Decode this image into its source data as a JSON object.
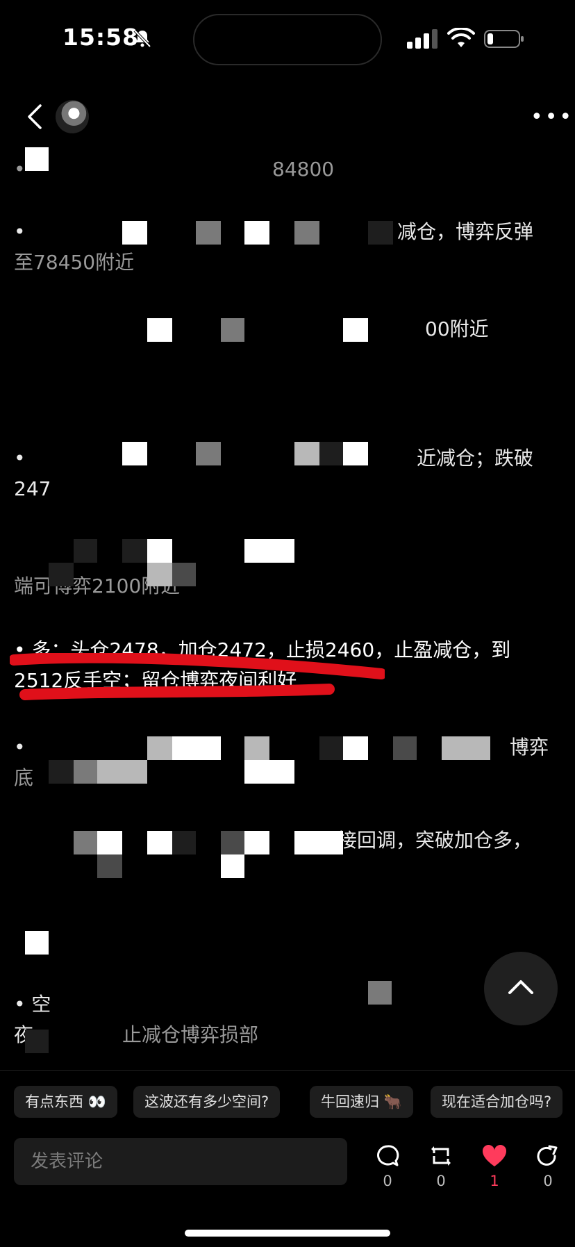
{
  "status": {
    "time": "15:58"
  },
  "post": {
    "lines": [
      {
        "text": "•",
        "tail": "84800"
      },
      {
        "text": "•",
        "tail": "减仓，博弈反弹"
      },
      {
        "text": "至78450附近"
      },
      {
        "text": "00附近"
      },
      {
        "text": "•",
        "tail": "近减仓；跌破"
      },
      {
        "text": "247"
      },
      {
        "text": "端可博弈2100附近"
      },
      {
        "text": "• 多：头仓2478，加仓2472，止损2460，止盈减仓，到"
      },
      {
        "text": "2512反手空；留仓博弈夜间利好"
      },
      {
        "text": "•",
        "tail": "博弈"
      },
      {
        "text": "底"
      },
      {
        "text": "接回调，突破加仓多，"
      },
      {
        "text": "• 空"
      },
      {
        "text": "夜",
        "tail": "止减仓博弈损部"
      }
    ]
  },
  "quick_replies": [
    "有点东西 👀",
    "这波还有多少空间?",
    "牛回速归 🐂",
    "现在适合加仓吗?"
  ],
  "comment": {
    "placeholder": "发表评论"
  },
  "actions": {
    "comment_count": "0",
    "repost_count": "0",
    "like_count": "1",
    "share_count": "0"
  },
  "colors": {
    "accent": "#ff3b5c",
    "highlight": "#e0101a"
  }
}
